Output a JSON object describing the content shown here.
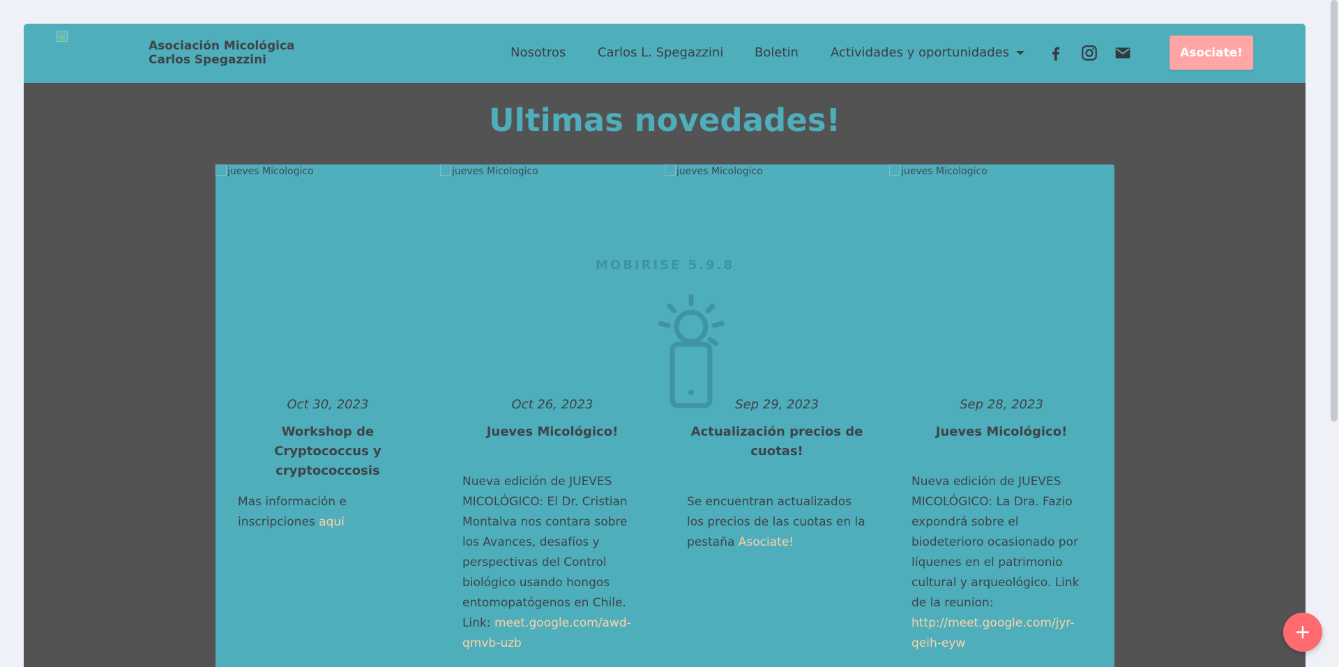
{
  "brand": {
    "logo_alt": "",
    "name_line1": "Asociación Micológica",
    "name_line2": "Carlos Spegazzini"
  },
  "nav": {
    "items": [
      {
        "label": "Nosotros"
      },
      {
        "label": "Carlos L. Spegazzini"
      },
      {
        "label": "Boletin"
      },
      {
        "label": "Actividades y oportunidades"
      }
    ],
    "social": [
      "facebook-icon",
      "instagram-icon",
      "mail-icon"
    ],
    "cta_label": "Asociate!"
  },
  "section": {
    "title": "Ultimas novedades!"
  },
  "watermark": {
    "text": "MOBIRISE  5.9.8",
    "icon": "phone-lightbulb-icon"
  },
  "cards": [
    {
      "image_alt": "jueves Micologico",
      "date": "Oct 30, 2023",
      "title": "Workshop de Cryptococcus y cryptococcosis",
      "text": "Mas información e inscripciones ",
      "link": "aquí"
    },
    {
      "image_alt": "jueves Micologico",
      "date": "Oct 26, 2023",
      "title": "Jueves Micológico!",
      "text": "Nueva edición de JUEVES MICOLÓGICO: El Dr. Cristian Montalva nos contara sobre los Avances, desafíos y perspectivas del Control biológico usando hongos entomopatógenos en Chile. Link: ",
      "link": "meet.google.com/awd-qmvb-uzb"
    },
    {
      "image_alt": "jueves Micologico",
      "date": "Sep 29, 2023",
      "title": "Actualización precios de cuotas!",
      "text": "Se encuentran actualizados los precios de las cuotas en la pestaña ",
      "link": "Asociate!"
    },
    {
      "image_alt": "jueves Micologico",
      "date": "Sep 28, 2023",
      "title": "Jueves Micológico!",
      "text": "Nueva edición de JUEVES MICOLÓGICO: La Dra. Fazio expondrá sobre el biodeterioro ocasionado por líquenes en el patrimonio cultural y arqueológico. Link de la reunion: ",
      "link": "http://meet.google.com/jyr-qeih-eyw"
    }
  ],
  "fab": {
    "icon": "plus-icon"
  },
  "colors": {
    "navbar": "#4faebb",
    "section_bg": "#535353",
    "accent": "#4faebb",
    "cta": "#ffa5a6",
    "link": "#ffd3a6",
    "fab": "#ff6a6f"
  }
}
